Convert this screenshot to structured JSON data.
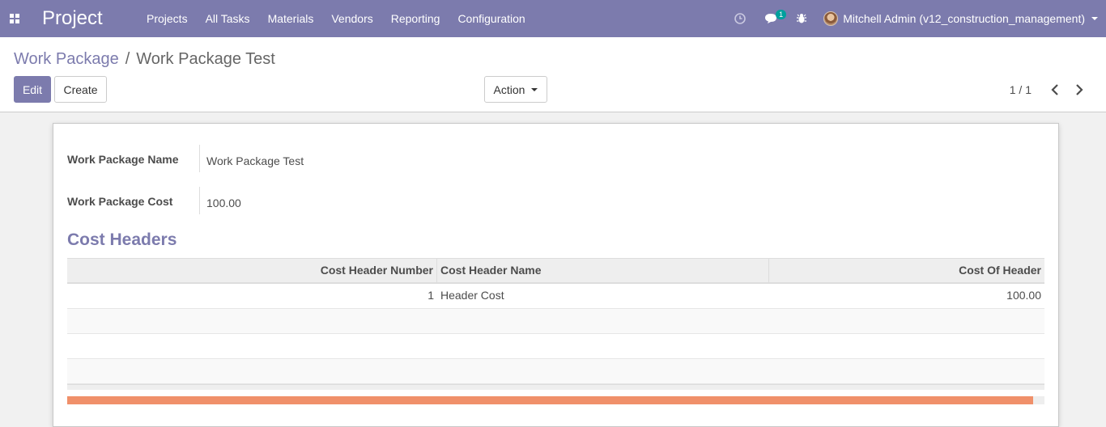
{
  "navbar": {
    "app_title": "Project",
    "menu": [
      "Projects",
      "All Tasks",
      "Materials",
      "Vendors",
      "Reporting",
      "Configuration"
    ],
    "messages_badge": "1",
    "user_name": "Mitchell Admin (v12_construction_management)"
  },
  "breadcrumb": {
    "parent": "Work Package",
    "separator": "/",
    "current": "Work Package Test"
  },
  "buttons": {
    "edit": "Edit",
    "create": "Create",
    "action": "Action"
  },
  "pager": {
    "value": "1 / 1"
  },
  "form": {
    "name_label": "Work Package Name",
    "name_value": "Work Package Test",
    "cost_label": "Work Package Cost",
    "cost_value": "100.00",
    "section_title": "Cost Headers"
  },
  "table": {
    "columns": [
      "Cost Header Number",
      "Cost Header Name",
      "Cost Of Header"
    ],
    "rows": [
      [
        "1",
        "Header Cost",
        "100.00"
      ]
    ]
  },
  "colors": {
    "brand": "#7c7bad",
    "badge": "#00a09d",
    "scrollbar_thumb": "#f0906a"
  },
  "icons": [
    "apps-grid-icon",
    "clock-icon",
    "chat-icon",
    "bug-icon",
    "chevron-left-icon",
    "chevron-right-icon"
  ]
}
